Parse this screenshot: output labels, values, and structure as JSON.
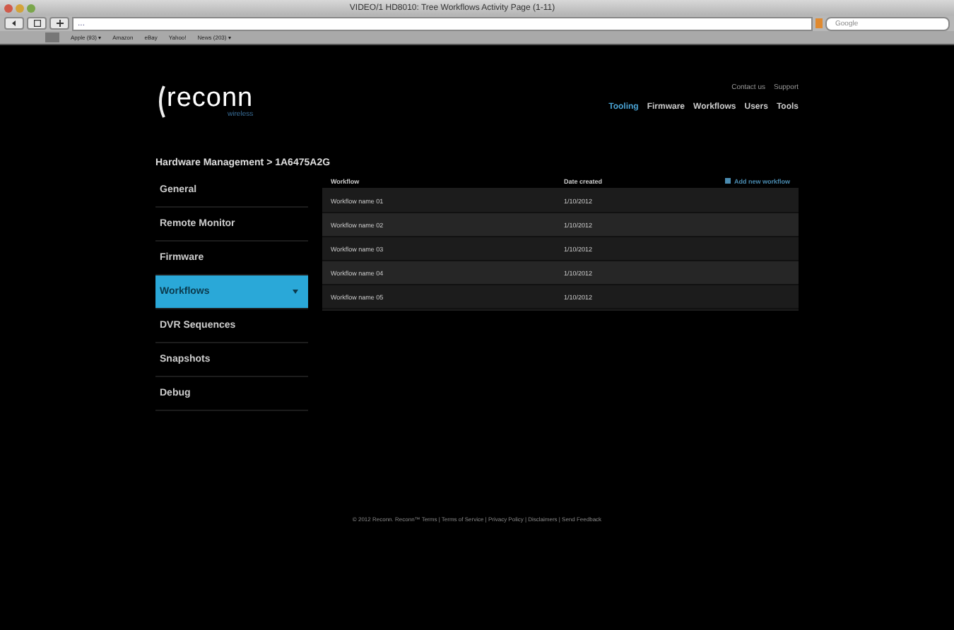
{
  "browser": {
    "title": "VIDEO/1 HD8010: Tree Workflows Activity Page (1-11)",
    "address": "...",
    "search_placeholder": "Google",
    "bookmarks": [
      "Apple (93) ▾",
      "Amazon",
      "eBay",
      "Yahoo!",
      "News (203) ▾"
    ]
  },
  "logo": {
    "name": "reconn",
    "tagline": "wireless"
  },
  "header": {
    "utility_links": [
      "Contact us",
      "Support"
    ],
    "nav": [
      {
        "label": "Tooling",
        "selected": true
      },
      {
        "label": "Firmware",
        "selected": false
      },
      {
        "label": "Workflows",
        "selected": false
      },
      {
        "label": "Users",
        "selected": false
      },
      {
        "label": "Tools",
        "selected": false
      }
    ]
  },
  "breadcrumb": "Hardware Management > 1A6475A2G",
  "sidebar": {
    "items": [
      {
        "label": "General",
        "selected": false
      },
      {
        "label": "Remote Monitor",
        "selected": false
      },
      {
        "label": "Firmware",
        "selected": false
      },
      {
        "label": "Workflows",
        "selected": true
      },
      {
        "label": "DVR Sequences",
        "selected": false
      },
      {
        "label": "Snapshots",
        "selected": false
      },
      {
        "label": "Debug",
        "selected": false
      }
    ]
  },
  "table": {
    "columns": [
      "Workflow",
      "Date created"
    ],
    "action": "Add new workflow",
    "rows": [
      [
        "Workflow name 01",
        "1/10/2012"
      ],
      [
        "Workflow name 02",
        "1/10/2012"
      ],
      [
        "Workflow name 03",
        "1/10/2012"
      ],
      [
        "Workflow name 04",
        "1/10/2012"
      ],
      [
        "Workflow name 05",
        "1/10/2012"
      ]
    ]
  },
  "footer": "© 2012 Reconn. Reconn™ Terms | Terms of Service | Privacy Policy | Disclaimers | Send Feedback"
}
